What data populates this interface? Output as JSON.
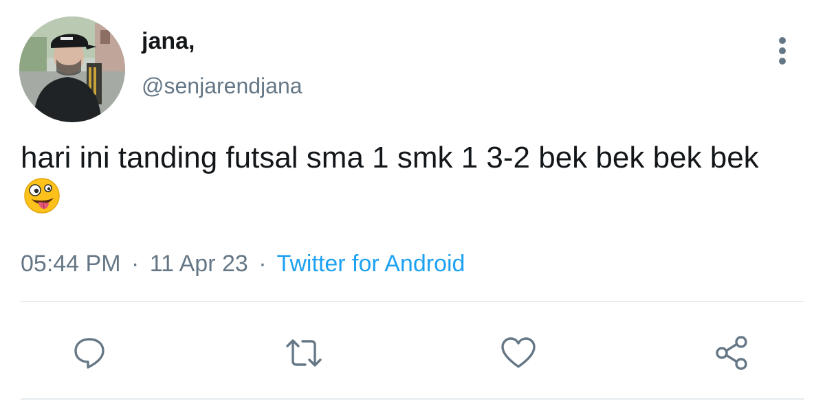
{
  "author": {
    "display_name": "jana,",
    "handle": "@senjarendjana"
  },
  "tweet": {
    "text": "hari ini tanding futsal sma 1 smk 1 3-2 bek bek bek bek",
    "emoji": "zany-face-emoji"
  },
  "meta": {
    "time": "05:44 PM",
    "separator": "·",
    "date": "11 Apr 23",
    "source": "Twitter for Android"
  },
  "icons": {
    "more": "more-vertical-icon",
    "reply": "reply-icon",
    "retweet": "retweet-icon",
    "like": "heart-icon",
    "share": "share-icon"
  },
  "colors": {
    "text": "#14171a",
    "secondary": "#657786",
    "link": "#1da1f2",
    "divider": "#e6ecf0"
  }
}
